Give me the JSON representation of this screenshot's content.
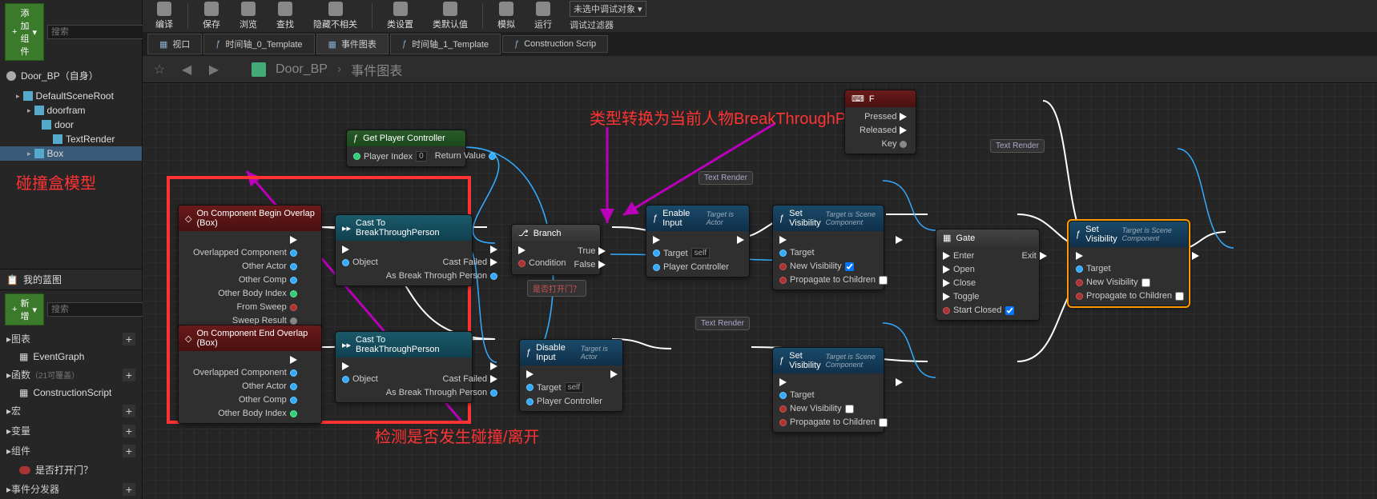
{
  "toolbar": {
    "buttons": [
      "编译",
      "保存",
      "浏览",
      "查找",
      "隐藏不相关",
      "类设置",
      "类默认值",
      "模拟",
      "运行"
    ],
    "debug_none": "未选中调试对象",
    "debug_filter": "调试过滤器"
  },
  "tabs": [
    {
      "icon": "viewport",
      "label": "视口"
    },
    {
      "icon": "f",
      "label": "时间轴_0_Template"
    },
    {
      "icon": "graph",
      "label": "事件图表"
    },
    {
      "icon": "f",
      "label": "时间轴_1_Template"
    },
    {
      "icon": "f",
      "label": "Construction Scrip"
    }
  ],
  "crumb": {
    "bp": "Door_BP",
    "graph": "事件图表"
  },
  "left": {
    "add_component": "添加组件",
    "search_ph": "搜索",
    "bp_self": "Door_BP（自身）",
    "tree": [
      {
        "ind": 1,
        "lbl": "DefaultSceneRoot"
      },
      {
        "ind": 2,
        "lbl": "doorfram"
      },
      {
        "ind": 3,
        "lbl": "door"
      },
      {
        "ind": 4,
        "lbl": "TextRender"
      },
      {
        "ind": 2,
        "lbl": "Box",
        "sel": true
      }
    ],
    "anno_box": "碰撞盒模型",
    "my_bp": "我的蓝图",
    "add_new": "新增",
    "sections": [
      {
        "lbl": "图表",
        "items": [
          "EventGraph"
        ]
      },
      {
        "lbl": "函数",
        "note": "（21可覆盖）",
        "items": [
          "ConstructionScript"
        ]
      },
      {
        "lbl": "宏"
      },
      {
        "lbl": "变量"
      },
      {
        "lbl": "组件",
        "items": [
          "是否打开门？"
        ]
      },
      {
        "lbl": "事件分发器"
      }
    ]
  },
  "annotations": {
    "cast": "类型转换为当前人物BreakThroughPerson",
    "overlap": "检测是否发生碰撞/离开"
  },
  "nodes": {
    "getpc": {
      "title": "Get Player Controller",
      "pi": "Player Index",
      "rv": "Return Value",
      "val": "0"
    },
    "beginOv": {
      "title": "On Component Begin Overlap (Box)",
      "p1": "Overlapped Component",
      "p2": "Other Actor",
      "p3": "Other Comp",
      "p4": "Other Body Index",
      "p5": "From Sweep",
      "p6": "Sweep Result"
    },
    "endOv": {
      "title": "On Component End Overlap (Box)",
      "p1": "Overlapped Component",
      "p2": "Other Actor",
      "p3": "Other Comp",
      "p4": "Other Body Index"
    },
    "cast": {
      "title": "Cast To BreakThroughPerson",
      "obj": "Object",
      "fail": "Cast Failed",
      "as": "As Break Through Person"
    },
    "branch": {
      "title": "Branch",
      "cond": "Condition",
      "t": "True",
      "f": "False",
      "var": "是否打开门？"
    },
    "enable": {
      "title": "Enable Input",
      "sub": "Target is Actor",
      "tgt": "Target",
      "self": "self",
      "pc": "Player Controller"
    },
    "disable": {
      "title": "Disable Input",
      "sub": "Target is Actor",
      "tgt": "Target",
      "self": "self",
      "pc": "Player Controller"
    },
    "setvis": {
      "title": "Set Visibility",
      "sub": "Target is Scene Component",
      "tgt": "Target",
      "nv": "New Visibility",
      "pc": "Propagate to Children"
    },
    "gate": {
      "title": "Gate",
      "enter": "Enter",
      "open": "Open",
      "close": "Close",
      "toggle": "Toggle",
      "sc": "Start Closed",
      "exit": "Exit"
    },
    "keyF": {
      "title": "F",
      "pressed": "Pressed",
      "released": "Released",
      "key": "Key"
    },
    "textrender": "Text Render"
  }
}
